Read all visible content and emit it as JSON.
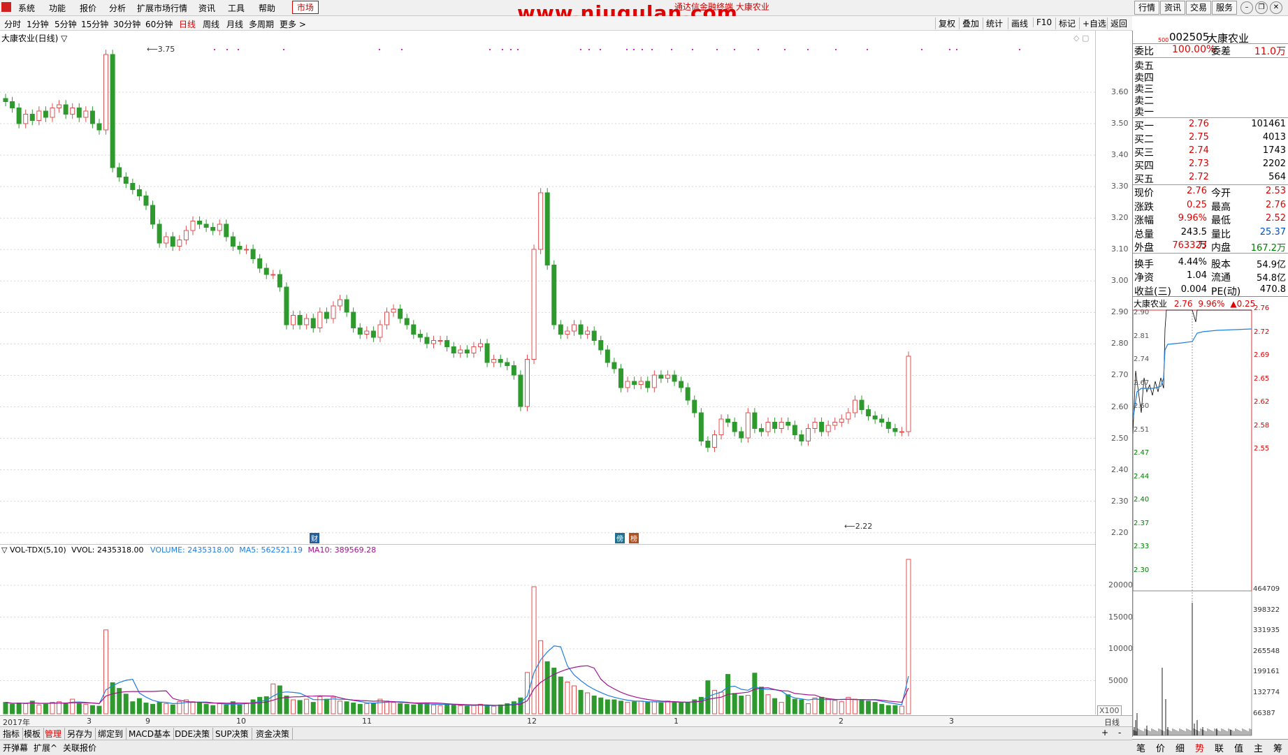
{
  "menu": {
    "items": [
      "系统",
      "功能",
      "报价",
      "分析",
      "扩展市场行情",
      "资讯",
      "工具",
      "帮助"
    ],
    "market": "市场",
    "watermark": "www.niugulan.com",
    "window_title": "通达信金融终端 大康农业",
    "top_buttons": [
      "行情",
      "资讯",
      "交易",
      "服务"
    ]
  },
  "periods": {
    "items": [
      "分时",
      "1分钟",
      "5分钟",
      "15分钟",
      "30分钟",
      "60分钟",
      "日线",
      "周线",
      "月线",
      "多周期",
      "更多 >"
    ],
    "active": "日线"
  },
  "toolbar_right": [
    "复权",
    "叠加",
    "统计",
    "画线",
    "F10",
    "标记",
    "+自选",
    "返回"
  ],
  "chart_title": "大康农业(日线) ▽",
  "price_axis": [
    "3.60",
    "3.50",
    "3.40",
    "3.30",
    "3.20",
    "3.10",
    "3.00",
    "2.90",
    "2.80",
    "2.70",
    "2.60",
    "2.50",
    "2.40",
    "2.30",
    "2.20"
  ],
  "vol_axis": [
    "20000",
    "15000",
    "10000",
    "5000"
  ],
  "vol_multiplier": "X100",
  "indicator_line": {
    "name": "▽ VOL-TDX(5,10)",
    "vvol": "VVOL: 2435318.00",
    "volume": "VOLUME: 2435318.00",
    "ma5": "MA5: 562521.19",
    "ma10": "MA10: 389569.28"
  },
  "max_label": "3.75",
  "min_label": "2.22",
  "event_badges": [
    "财",
    "傍",
    "榜"
  ],
  "time_axis": [
    "2017年",
    "3",
    "9",
    "10",
    "11",
    "12",
    "1",
    "2",
    "3"
  ],
  "period_label": "日线",
  "pm_buttons": [
    "+",
    "-"
  ],
  "bottom_tabs": [
    "指标",
    "模板",
    "管理",
    "另存为",
    "绑定到",
    "MACD基本",
    "DDE决策",
    "SUP决策",
    "资金决策"
  ],
  "status_items": [
    "开弹幕",
    "扩展^",
    "关联报价"
  ],
  "quote": {
    "code_prefix": "500",
    "code": "002505",
    "name": "大康农业",
    "weibi_label": "委比",
    "weibi": "100.00%",
    "weicha_label": "委差",
    "weicha": "11.0万",
    "sells": [
      "卖五",
      "卖四",
      "卖三",
      "卖二",
      "卖一"
    ],
    "buys": [
      {
        "label": "买一",
        "price": "2.76",
        "vol": "101461"
      },
      {
        "label": "买二",
        "price": "2.75",
        "vol": "4013"
      },
      {
        "label": "买三",
        "price": "2.74",
        "vol": "1743"
      },
      {
        "label": "买四",
        "price": "2.73",
        "vol": "2202"
      },
      {
        "label": "买五",
        "price": "2.72",
        "vol": "564"
      }
    ],
    "stats": [
      {
        "l1": "现价",
        "v1": "2.76",
        "c1": "red",
        "l2": "今开",
        "v2": "2.53",
        "c2": "red"
      },
      {
        "l1": "涨跌",
        "v1": "0.25",
        "c1": "red",
        "l2": "最高",
        "v2": "2.76",
        "c2": "red"
      },
      {
        "l1": "涨幅",
        "v1": "9.96%",
        "c1": "red",
        "l2": "最低",
        "v2": "2.52",
        "c2": "red"
      },
      {
        "l1": "总量",
        "v1": "243.5万",
        "c1": "black",
        "l2": "量比",
        "v2": "25.37",
        "c2": "blue"
      },
      {
        "l1": "外盘",
        "v1": "763323",
        "c1": "red",
        "l2": "内盘",
        "v2": "167.2万",
        "c2": "green"
      },
      {
        "l1": "换手",
        "v1": "4.44%",
        "c1": "black",
        "l2": "股本",
        "v2": "54.9亿",
        "c2": "black"
      },
      {
        "l1": "净资",
        "v1": "1.04",
        "c1": "black",
        "l2": "流通",
        "v2": "54.8亿",
        "c2": "black"
      },
      {
        "l1": "收益(三)",
        "v1": "0.004",
        "c1": "black",
        "l2": "PE(动)",
        "v2": "470.8",
        "c2": "black"
      }
    ]
  },
  "mini": {
    "title": "大康农业",
    "price": "2.76",
    "pct": "9.96%",
    "chg": "▲0.25",
    "left_axis": [
      "2.90",
      "2.81",
      "2.74",
      "2.67",
      "2.60",
      "2.51",
      "2.47",
      "2.44",
      "2.40",
      "2.37",
      "2.33",
      "2.30"
    ],
    "right_axis": [
      "2.76",
      "2.72",
      "2.69",
      "2.65",
      "2.62",
      "2.58",
      "2.55"
    ],
    "vol_axis": [
      "464709",
      "398322",
      "331935",
      "265548",
      "199161",
      "132774",
      "66387"
    ]
  },
  "right_tabs": [
    "笔",
    "价",
    "细",
    "势",
    "联",
    "值",
    "主",
    "筹"
  ],
  "right_tab_active": "势",
  "colors": {
    "up": "#e05050",
    "down": "#2e9a2e",
    "ma5": "#1f7fe0",
    "ma10": "#a0148c",
    "accent": "#e00000"
  }
}
